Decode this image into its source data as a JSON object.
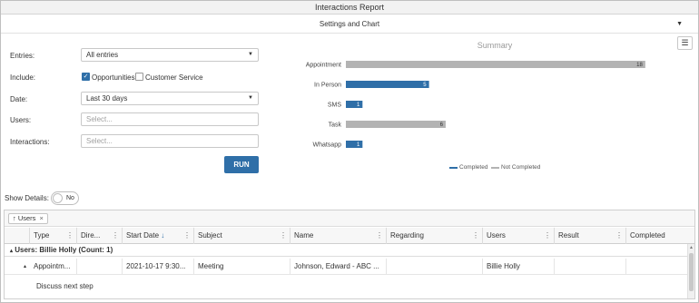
{
  "window": {
    "title": "Interactions Report"
  },
  "settings": {
    "label": "Settings and Chart",
    "caret": "▼"
  },
  "form": {
    "entries_label": "Entries:",
    "entries_value": "All entries",
    "include_label": "Include:",
    "opportunities_label": "Opportunities",
    "opportunities_checked": true,
    "customer_service_label": "Customer Service",
    "customer_service_checked": false,
    "date_label": "Date:",
    "date_value": "Last 30 days",
    "users_label": "Users:",
    "users_placeholder": "Select...",
    "interactions_label": "Interactions:",
    "interactions_placeholder": "Select...",
    "run_label": "RUN"
  },
  "menu_icon": "hamburger-menu-icon",
  "chart_data": {
    "type": "bar",
    "orientation": "horizontal",
    "title": "Summary",
    "categories": [
      "Appointment",
      "In Person",
      "SMS",
      "Task",
      "Whatsapp"
    ],
    "series": [
      {
        "name": "Completed",
        "color": "#2f6fa8",
        "values": [
          0,
          5,
          1,
          0,
          1
        ]
      },
      {
        "name": "Not Completed",
        "color": "#b3b3b3",
        "values": [
          18,
          0,
          0,
          6,
          0
        ]
      }
    ],
    "data_labels": [
      "18",
      "5",
      "1",
      "6",
      "1"
    ],
    "xlim": [
      0,
      18.5
    ],
    "legend_position": "bottom",
    "grid": false
  },
  "details": {
    "label": "Show Details:",
    "toggle_text": "No"
  },
  "grid": {
    "group_chip": {
      "arrow": "↑",
      "label": "Users",
      "close": "×"
    },
    "columns": [
      "Type",
      "Dire...",
      "Start Date",
      "Subject",
      "Name",
      "Regarding",
      "Users",
      "Result",
      "Completed"
    ],
    "sort_arrow": "↓",
    "group_row": "Users: Billie Holly (Count: 1)",
    "rows": [
      {
        "expander": "▴",
        "type": "Appointm...",
        "direction": "",
        "start_date": "2021-10-17 9:30...",
        "subject": "Meeting",
        "name": "Johnson, Edward - ABC ...",
        "regarding": "",
        "users": "Billie Holly",
        "result": "",
        "completed": ""
      }
    ],
    "detail_text": "Discuss next step"
  }
}
